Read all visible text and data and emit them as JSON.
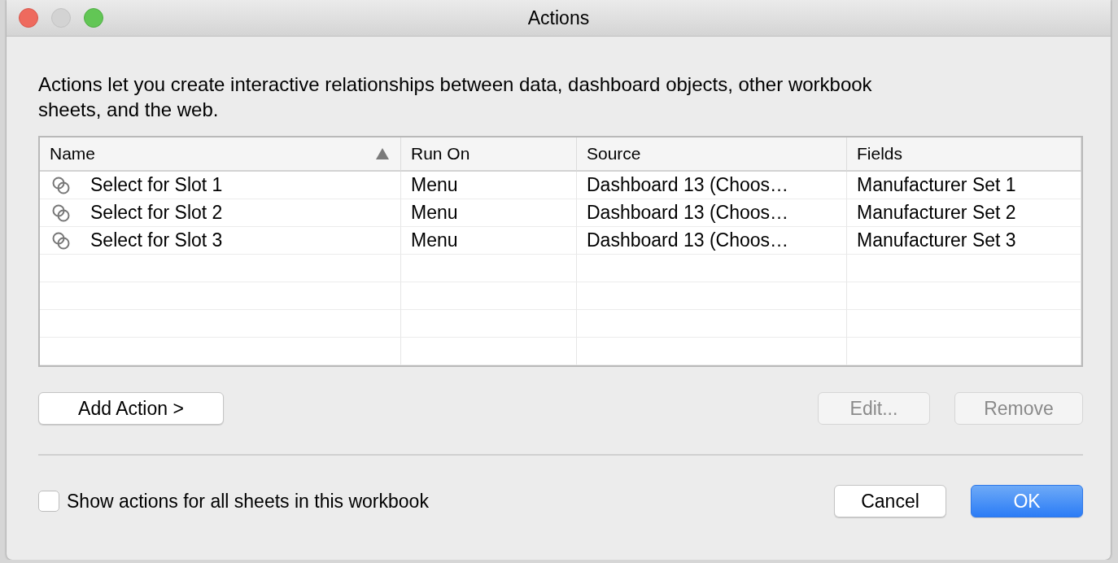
{
  "window": {
    "title": "Actions"
  },
  "description": "Actions let you create interactive relationships between data, dashboard objects, other workbook sheets, and the web.",
  "table": {
    "columns": [
      {
        "label": "Name",
        "sorted": true
      },
      {
        "label": "Run On",
        "sorted": false
      },
      {
        "label": "Source",
        "sorted": false
      },
      {
        "label": "Fields",
        "sorted": false
      }
    ],
    "rows": [
      {
        "name": "Select for Slot 1",
        "run_on": "Menu",
        "source": "Dashboard 13 (Choos…",
        "fields": "Manufacturer Set 1"
      },
      {
        "name": "Select for Slot 2",
        "run_on": "Menu",
        "source": "Dashboard 13 (Choos…",
        "fields": "Manufacturer Set 2"
      },
      {
        "name": "Select for Slot 3",
        "run_on": "Menu",
        "source": "Dashboard 13 (Choos…",
        "fields": "Manufacturer Set 3"
      }
    ]
  },
  "list_buttons": [
    {
      "label": "Add Action >",
      "disabled": false
    },
    {
      "label": "Edit...",
      "disabled": true
    },
    {
      "label": "Remove",
      "disabled": true
    }
  ],
  "checkbox": {
    "label": "Show actions for all sheets in this workbook",
    "checked": false
  },
  "footer_buttons": [
    {
      "label": "Cancel",
      "default": false
    },
    {
      "label": "OK",
      "default": true
    }
  ]
}
